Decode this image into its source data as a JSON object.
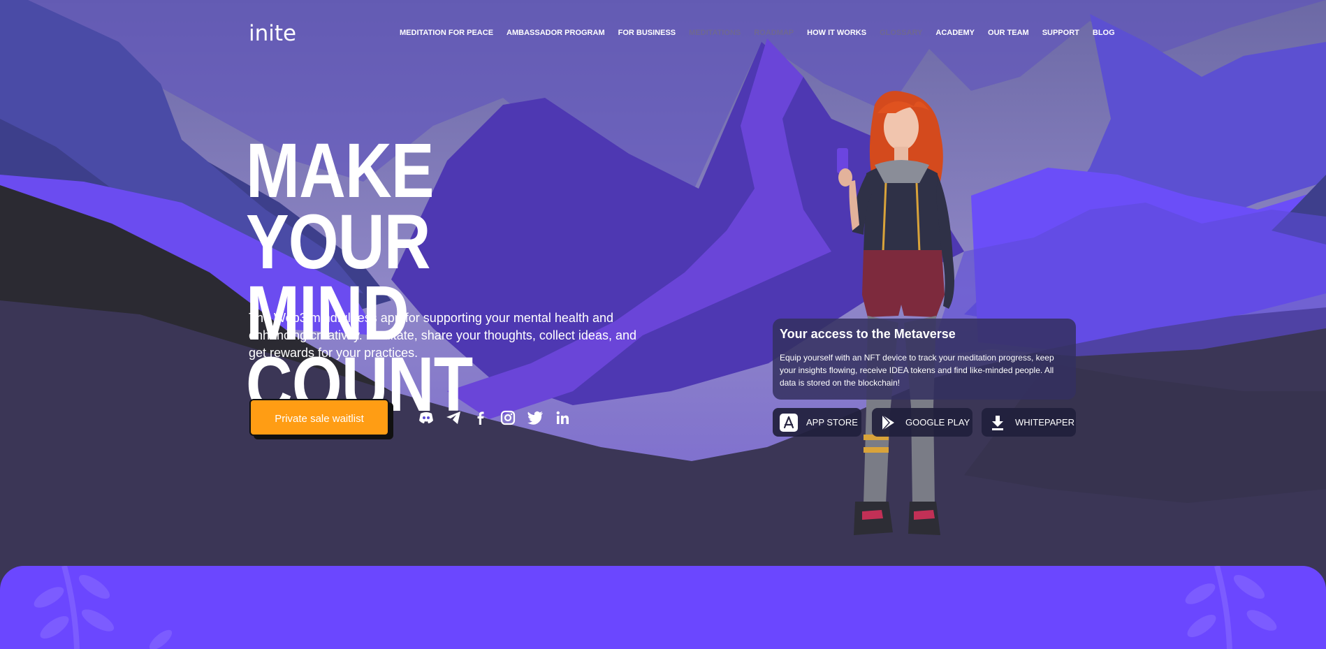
{
  "brand": {
    "logo": "inite"
  },
  "nav": {
    "items": [
      {
        "label": "MEDITATION FOR PEACE",
        "dim": false
      },
      {
        "label": "AMBASSADOR PROGRAM",
        "dim": false
      },
      {
        "label": "FOR BUSINESS",
        "dim": false
      },
      {
        "label": "MEDITATIONS",
        "dim": true
      },
      {
        "label": "ROADMAP",
        "dim": true
      },
      {
        "label": "HOW IT WORKS",
        "dim": false
      },
      {
        "label": "GLOSSARY",
        "dim": true
      },
      {
        "label": "ACADEMY",
        "dim": false
      },
      {
        "label": "OUR TEAM",
        "dim": false
      },
      {
        "label": "SUPPORT",
        "dim": false
      },
      {
        "label": "BLOG",
        "dim": false
      }
    ]
  },
  "hero": {
    "title_line1": "MAKE YOUR",
    "title_line2": "MIND COUNT",
    "description": "The Web3 mindfulness app for supporting your mental health and enhancing creativity. Meditate, share your thoughts, collect ideas, and get rewards for your practices.",
    "cta_label": "Private sale waitlist"
  },
  "socials": [
    "discord-icon",
    "telegram-icon",
    "facebook-icon",
    "instagram-icon",
    "twitter-icon",
    "linkedin-icon"
  ],
  "metaverse_card": {
    "title": "Your access to the Metaverse",
    "text": "Equip yourself with an NFT device to track your meditation progress, keep your insights flowing, receive IDEA tokens and find like-minded people. All data is stored on the blockchain!"
  },
  "buttons": {
    "app_store": "APP STORE",
    "google_play": "GOOGLE PLAY",
    "whitepaper": "WHITEPAPER"
  },
  "colors": {
    "accent": "#ff9d14",
    "purple": "#6b47ff",
    "dark": "#3b3656"
  }
}
